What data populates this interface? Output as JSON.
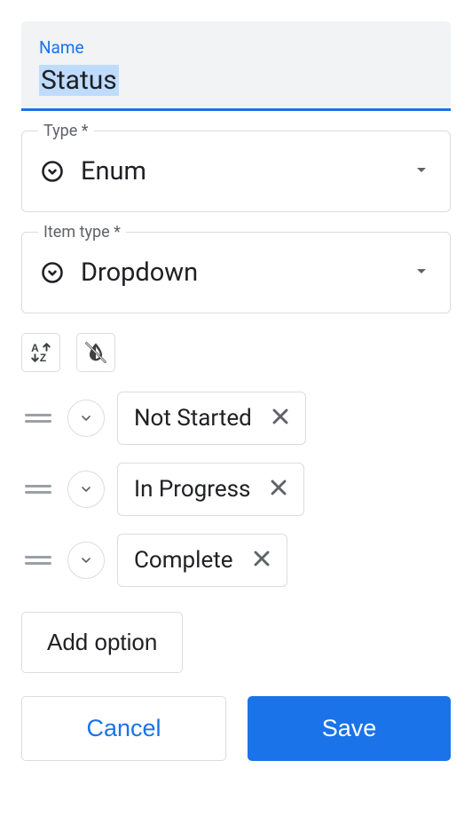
{
  "nameField": {
    "label": "Name",
    "value": "Status"
  },
  "typeField": {
    "label": "Type *",
    "value": "Enum"
  },
  "itemTypeField": {
    "label": "Item type *",
    "value": "Dropdown"
  },
  "options": [
    {
      "label": "Not Started"
    },
    {
      "label": "In Progress"
    },
    {
      "label": "Complete"
    }
  ],
  "buttons": {
    "addOption": "Add option",
    "cancel": "Cancel",
    "save": "Save"
  },
  "icons": {
    "sort": "sort-az",
    "colorOff": "invert-colors-off"
  }
}
